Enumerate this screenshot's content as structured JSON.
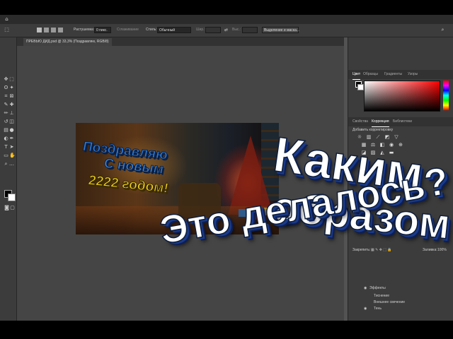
{
  "window": {
    "document_tab": "ПРЕВЬЮ ДИД.psd @ 33,3% (Поздравляю, RGB/8)"
  },
  "options_bar": {
    "feather_label": "Растушевка:",
    "feather_value": "0 пикс.",
    "antialias_label": "Сглаживание",
    "style_label": "Стиль:",
    "style_value": "Обычный",
    "width_label": "Шир.:",
    "height_label": "Выс.:",
    "select_mask_button": "Выделение и маска..."
  },
  "color_panel": {
    "tabs": [
      "Цвет",
      "Образцы",
      "Градиенты",
      "Узоры"
    ],
    "active_tab": "Цвет",
    "foreground_color": "#000000",
    "background_color": "#ffffff",
    "picker_hue_color": "#ff0000"
  },
  "adjustments_panel": {
    "tabs": [
      "Свойства",
      "Коррекция",
      "Библиотеки"
    ],
    "active_tab": "Коррекция",
    "add_adjustment_label": "Добавить корректировку"
  },
  "layers_panel": {
    "lock_label": "Закрепить:",
    "fill_label": "Заливка:",
    "fill_value": "100%",
    "effects_label": "Эффекты",
    "effects": [
      "Тиснение",
      "Внешнее свечение",
      "Тень"
    ]
  },
  "artwork": {
    "line1": "Поздравляю",
    "line2": "С новым",
    "line3": "2222 годом!"
  },
  "overlay_caption": {
    "line1": "Каким",
    "line2": "образом",
    "line3": "Это делалось?"
  },
  "colors": {
    "app_bg": "#535353",
    "panel_bg": "#3c3c3c",
    "artwork_blue": "#2f7ad6",
    "artwork_yellow": "#f2d321",
    "caption_white": "#ffffff",
    "caption_shadow": "#1a3a8a"
  }
}
